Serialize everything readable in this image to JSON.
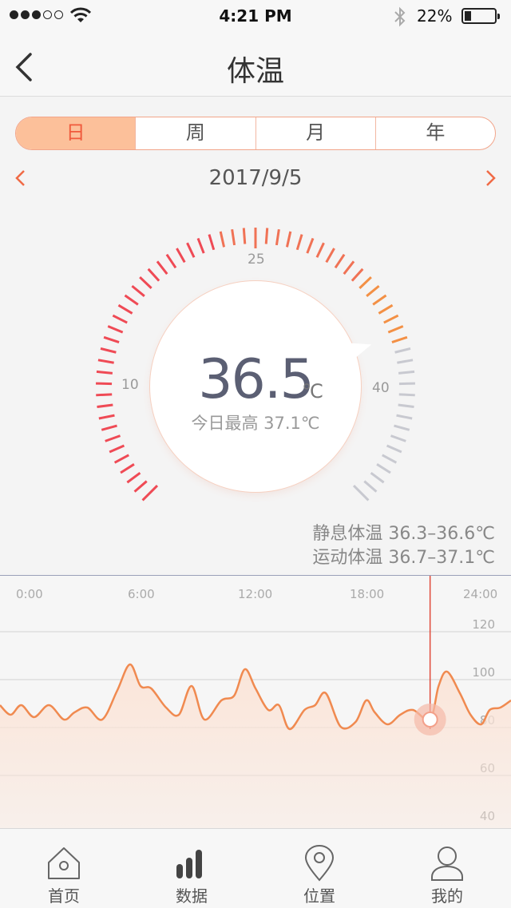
{
  "status": {
    "time": "4:21 PM",
    "battery": "22%"
  },
  "nav": {
    "title": "体温"
  },
  "segments": [
    "日",
    "周",
    "月",
    "年"
  ],
  "date": "2017/9/5",
  "gauge": {
    "value": "36.5",
    "unit": "℃",
    "sub": "今日最高  37.1℃",
    "scale_labels": [
      "10",
      "25",
      "40"
    ]
  },
  "ranges": {
    "rest": "静息体温  36.3–36.6℃",
    "active": "运动体温  36.7–37.1℃"
  },
  "chart_data": {
    "type": "area",
    "x_ticks": [
      "0:00",
      "6:00",
      "12:00",
      "18:00",
      "24:00"
    ],
    "y_ticks": [
      "120",
      "100",
      "80",
      "60",
      "40"
    ],
    "ylim": [
      40,
      130
    ],
    "xlim": [
      0,
      24
    ],
    "selected_hour": 20.2,
    "x": [
      0,
      0.5,
      1,
      1.6,
      2.3,
      3,
      3.5,
      4.1,
      4.8,
      5.5,
      6.1,
      6.6,
      7.1,
      7.8,
      8.4,
      9,
      9.6,
      10.4,
      11,
      11.5,
      12,
      12.6,
      13.1,
      13.6,
      14.3,
      14.8,
      15.3,
      16,
      16.7,
      17.2,
      17.6,
      18.2,
      18.8,
      19.4,
      20.2,
      20.6,
      21,
      21.6,
      22.1,
      22.6,
      23,
      23.5,
      24
    ],
    "y": [
      86,
      82,
      86,
      81,
      86,
      80,
      83,
      85,
      80,
      92,
      103,
      94,
      93,
      85,
      82,
      94,
      80,
      88,
      90,
      101,
      93,
      84,
      86,
      76,
      84,
      86,
      91,
      77,
      79,
      88,
      83,
      78,
      82,
      84,
      80,
      94,
      100,
      91,
      82,
      78,
      84,
      85,
      88
    ],
    "colors": {
      "line": "#f08a50",
      "fill": "#fbe4d7",
      "cursor": "#e04a3a"
    }
  },
  "tabs": [
    {
      "label": "首页",
      "icon": "home-icon"
    },
    {
      "label": "数据",
      "icon": "bar-chart-icon"
    },
    {
      "label": "位置",
      "icon": "location-pin-icon"
    },
    {
      "label": "我的",
      "icon": "profile-icon"
    }
  ]
}
